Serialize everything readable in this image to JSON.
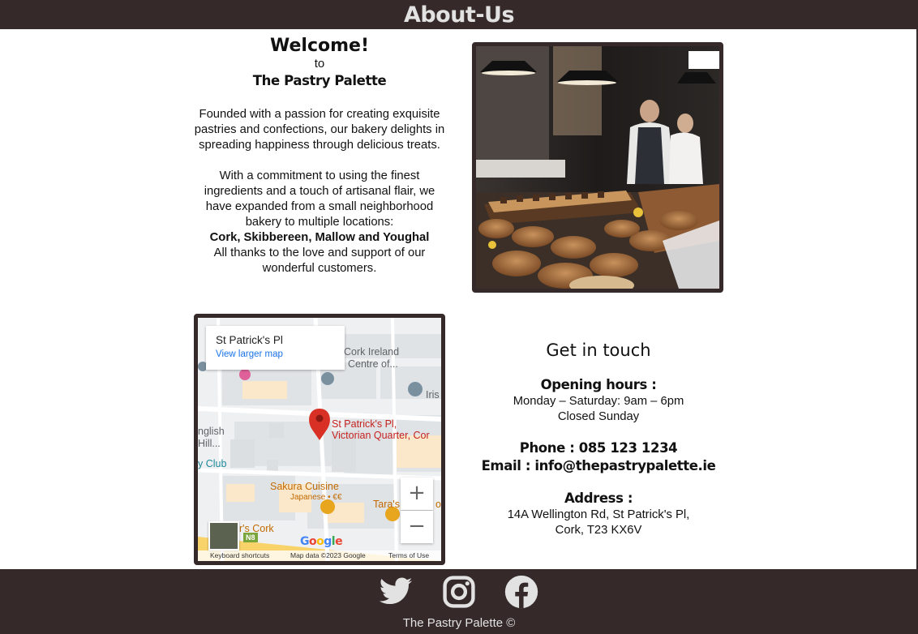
{
  "header": {
    "title": "About-Us"
  },
  "welcome": {
    "title": "Welcome!",
    "to": "to",
    "name": "The Pastry Palette",
    "paragraph1": "Founded with a passion for creating exquisite pastries and confections, our bakery delights in spreading happiness through delicious treats.",
    "paragraph2": "With a commitment to using the finest ingredients and a touch of artisanal flair, we have expanded from a small neighborhood bakery to multiple locations:",
    "towns": "Cork, Skibbereen, Mallow and Youghal",
    "paragraph3": "All thanks to the love and support of our wonderful customers."
  },
  "map": {
    "place_name": "St Patrick's Pl",
    "view_larger": "View larger map",
    "labels": {
      "cork_ireland": "Cork Ireland",
      "centre_of": "Centre of...",
      "iris": "Iris",
      "pin_line1": "St Patrick's Pl,",
      "pin_line2": "Victorian Quarter, Cor",
      "english": "nglish",
      "hill": "Hill...",
      "club": "y Club",
      "sakura": "Sakura Cuisine",
      "sakura_sub": "Japanese • €€",
      "taras": "Tara's",
      "taras_suffix": "o",
      "cork_bottom": "er's Cork",
      "road": "N8",
      "google": "Google"
    },
    "zoom_in": "+",
    "zoom_out": "−",
    "footer": {
      "shortcuts": "Keyboard shortcuts",
      "map_data": "Map data ©2023 Google",
      "terms": "Terms of Use"
    }
  },
  "contact": {
    "title": "Get in touch",
    "hours_heading": "Opening hours :",
    "hours_week": "Monday – Saturday: 9am – 6pm",
    "hours_sunday": "Closed Sunday",
    "phone": "Phone : 085 123 1234",
    "email": "Email : info@thepastrypalette.ie",
    "address_heading": "Address :",
    "address_line1": "14A Wellington Rd, St Patrick's Pl,",
    "address_line2": "Cork, T23 KX6V"
  },
  "footer": {
    "social": [
      "twitter-icon",
      "instagram-icon",
      "facebook-icon"
    ],
    "copyright": "The Pastry Palette ©"
  },
  "colors": {
    "brand_dark": "#35292a",
    "header_text": "#e2e2e2",
    "link_blue": "#1a73e8",
    "map_pin": "#d93025"
  }
}
